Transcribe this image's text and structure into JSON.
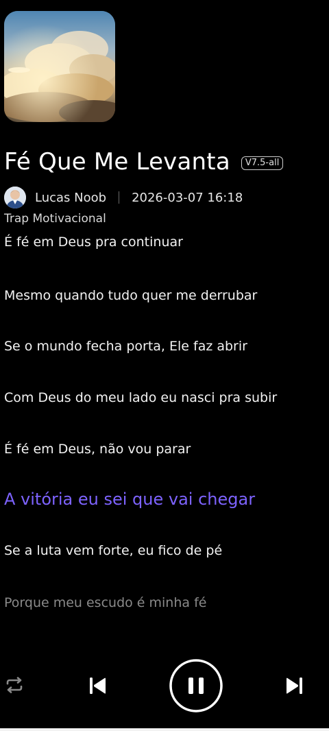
{
  "song": {
    "title": "Fé Que Me Levanta",
    "version": "V7.5-all",
    "author": "Lucas Noob",
    "created": "2026-03-07 16:18",
    "genre": "Trap Motivacional"
  },
  "lyrics": [
    {
      "text": "É fé em Deus pra continuar",
      "state": "past"
    },
    {
      "text": "Mesmo quando tudo quer me derrubar",
      "state": "past"
    },
    {
      "text": "Se o mundo fecha porta, Ele faz abrir",
      "state": "past"
    },
    {
      "text": "Com Deus do meu lado eu nasci pra subir",
      "state": "past"
    },
    {
      "text": "É fé em Deus, não vou parar",
      "state": "past"
    },
    {
      "text": "A vitória eu sei que vai chegar",
      "state": "active"
    },
    {
      "text": "Se a luta vem forte, eu fico de pé",
      "state": "upcoming"
    },
    {
      "text": "Porque meu escudo é minha fé",
      "state": "dim"
    }
  ],
  "player": {
    "state": "playing",
    "icons": [
      "repeat-icon",
      "previous-icon",
      "pause-icon",
      "next-icon"
    ]
  },
  "colors": {
    "background": "#000000",
    "accent": "#7d63ff",
    "text": "#ffffff",
    "dim_text": "#8a8a8a"
  }
}
